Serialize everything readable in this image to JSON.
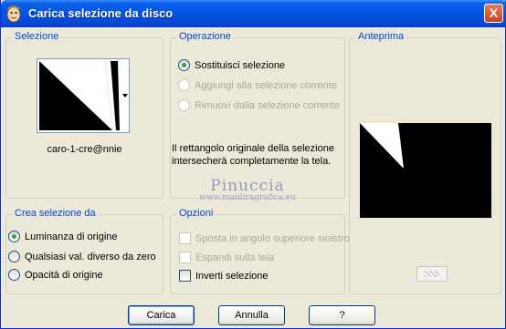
{
  "window": {
    "title": "Carica selezione da disco",
    "close_glyph": "X"
  },
  "groups": {
    "selezione": "Selezione",
    "operazione": "Operazione",
    "anteprima": "Anteprima",
    "crea": "Crea selezione da",
    "opzioni": "Opzioni"
  },
  "selection_file": "caro-1-cre@nnie",
  "operation_options": [
    {
      "label": "Sostituisci selezione",
      "checked": true,
      "enabled": true
    },
    {
      "label": "Aggiungi alla selezione corrente",
      "checked": false,
      "enabled": false
    },
    {
      "label": "Rimuovi dalla selezione corrente",
      "checked": false,
      "enabled": false
    }
  ],
  "info_text": "Il rettangolo originale della selezione intersecherà completamente la tela.",
  "source_options": [
    {
      "label": "Luminanza di origine",
      "checked": true
    },
    {
      "label": "Qualsiasi val. diverso da zero",
      "checked": false
    },
    {
      "label": "Opacità di origine",
      "checked": false
    }
  ],
  "options": [
    {
      "label": "Sposta in angolo superiore sinistro",
      "checked": false,
      "enabled": false
    },
    {
      "label": "Espandi sulla tela",
      "checked": false,
      "enabled": false
    },
    {
      "label": "Inverti selezione",
      "checked": false,
      "enabled": true
    }
  ],
  "buttons": {
    "ok": "Carica",
    "cancel": "Annulla",
    "help": "?"
  },
  "watermark": {
    "title": "Pinuccia",
    "url": "www.maidiragrafica.eu"
  },
  "icons": {
    "app": "paint-shop-icon",
    "dropdown": "chevron-down-icon"
  }
}
